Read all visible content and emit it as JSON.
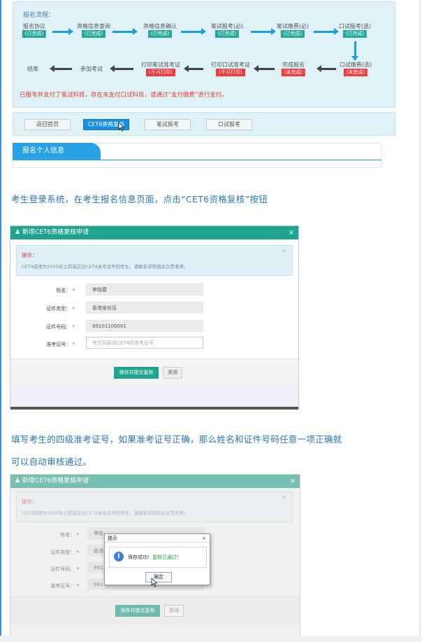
{
  "step1": {
    "flow_title": "报名流程：",
    "row1": [
      {
        "label": "报名协议",
        "status": "(已完成)",
        "state": "done"
      },
      {
        "label": "资格信息查询",
        "status": "(已完成)",
        "state": "done"
      },
      {
        "label": "资格信息确认",
        "status": "(已完成)",
        "state": "done"
      },
      {
        "label": "笔试报考(必)",
        "status": "(已完成)",
        "state": "done"
      },
      {
        "label": "笔试缴费(必)",
        "status": "(已完成)",
        "state": "done"
      },
      {
        "label": "口试报考(选)",
        "status": "(已完成)",
        "state": "done"
      }
    ],
    "row2": [
      {
        "label": "结束",
        "status": ""
      },
      {
        "label": "参加考试",
        "status": ""
      },
      {
        "label": "打印笔试准考证",
        "status": "(不可打印)",
        "state": "todo"
      },
      {
        "label": "打印口试准考证",
        "status": "(不可打印)",
        "state": "todo"
      },
      {
        "label": "完成报名",
        "status": "(未完成)",
        "state": "todo"
      },
      {
        "label": "口试缴费(选)",
        "status": "(未完成)",
        "state": "todo"
      }
    ],
    "notice": "已报考并支付了笔试科目，存在未支付口试科目，请通过“支付缴费”进行支付。",
    "buttons": {
      "back": "返回首页",
      "cet6": "CET6资格复核",
      "written": "笔试报考",
      "oral": "口试报考"
    },
    "section_title": "报名个人信息",
    "colors": {
      "done": "#23a89b",
      "todo": "#ef3c3c",
      "arrow": "#1a9be6",
      "accent": "#2aa0e6"
    }
  },
  "caption1": "考生登录系统，在考生报名信息页面，点击“CET6资格复核”按钮",
  "dialog": {
    "title": "新增CET6资格复核申请",
    "tip_title": "提示：",
    "tip_text": "CET4成绩为2005年之前或忘记CET4准考证号的考生，请联系学校相关负责老师。",
    "fields": {
      "name_label": "姓名：",
      "name_value": "李晓春",
      "idtype_label": "证件类型：",
      "idtype_value": "香港身份证",
      "idno_label": "证件号码：",
      "idno_value": "99101100001",
      "ticket_label": "准考证号：",
      "ticket_placeholder": "考生四级成CET4的准考证号"
    },
    "required_mark": "*",
    "save_button": "保存并提交复核",
    "close_button": "关闭",
    "close_icon": "×"
  },
  "caption2": {
    "line1": "填写考生的四级准考证号，如果准考证号正确，那么姓名和证件号码任意一项正确就",
    "line2": "可以自动审核通过。"
  },
  "dialog2": {
    "name_value_partial": "李晓",
    "idtype_value_partial": "香港",
    "idno_value_partial": "991",
    "ticket_value_partial": "991",
    "popup": {
      "title": "提示",
      "message_prefix": "保存成功！",
      "message_ok": "复核已通过！",
      "ok_button": "确定",
      "close_icon": "×",
      "icon": "info-icon"
    }
  }
}
